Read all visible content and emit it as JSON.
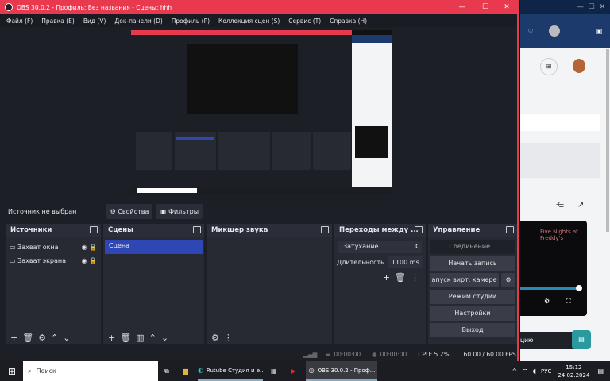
{
  "window": {
    "title": "OBS 30.0.2 - Профиль: Без названия - Сцены: hhh",
    "minimize": "—",
    "maximize": "☐",
    "close": "✕"
  },
  "menu": [
    "Файл (F)",
    "Правка (E)",
    "Вид (V)",
    "Док-панели (D)",
    "Профиль (P)",
    "Коллекция сцен (S)",
    "Сервис (T)",
    "Справка (H)"
  ],
  "source_bar": {
    "status": "Источник не выбран",
    "properties": "Свойства",
    "filters": "Фильтры"
  },
  "sources": {
    "title": "Источники",
    "items": [
      "Захват окна",
      "Захват экрана"
    ]
  },
  "scenes": {
    "title": "Сцены",
    "items": [
      "Сцена"
    ]
  },
  "mixer": {
    "title": "Микшер звука"
  },
  "transitions": {
    "title": "Переходы между ...",
    "type": "Затухание",
    "duration_label": "Длительность",
    "duration": "1100 ms"
  },
  "controls": {
    "title": "Управление",
    "buttons": [
      "Соединение...",
      "Начать запись",
      "апуск вирт. камере",
      "Режим студии",
      "Настройки",
      "Выход"
    ]
  },
  "status": {
    "stream_time": "00:00:00",
    "rec_time": "00:00:00",
    "cpu": "CPU: 5.2%",
    "fps": "60.00 / 60.00 FPS"
  },
  "browser": {
    "video_title": "Five Nights at Freddy's",
    "banner": "цию"
  },
  "taskbar": {
    "search": "Поиск",
    "apps": [
      "Rutube Студия и е...",
      "OBS 30.0.2 - Проф..."
    ],
    "lang": "РУС",
    "time": "15:12",
    "date": "24.02.2024"
  }
}
